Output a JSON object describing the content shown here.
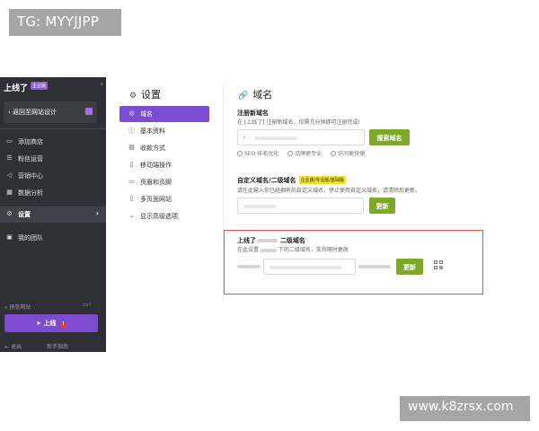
{
  "watermark": {
    "tag": "TG: MYYJJPP",
    "site": "www.k8zrsx.com"
  },
  "sidebar": {
    "logo": "上线了",
    "badge": "企业版",
    "collapse_icon": "chevron-left",
    "back_label": "返回至网站设计",
    "items": [
      {
        "label": "添加商店",
        "icon": "store-icon"
      },
      {
        "label": "粉丝运营",
        "icon": "fans-icon"
      },
      {
        "label": "营销中心",
        "icon": "megaphone-icon"
      },
      {
        "label": "数据分析",
        "icon": "chart-icon"
      },
      {
        "label": "设置",
        "icon": "gear-icon",
        "active": true
      },
      {
        "label": "我的团队",
        "icon": "team-icon"
      }
    ],
    "search_label": "预览网站",
    "publish_label": "上线",
    "publish_badge": "!",
    "bottom_left": "退出",
    "bottom_right": "新手指南"
  },
  "settings": {
    "title": "设置",
    "menu": [
      {
        "label": "域名",
        "icon": "globe-icon",
        "active": true
      },
      {
        "label": "基本资料",
        "icon": "info-icon"
      },
      {
        "label": "收款方式",
        "icon": "card-icon"
      },
      {
        "label": "移动端操作",
        "icon": "mobile-icon"
      },
      {
        "label": "页眉和页脚",
        "icon": "layout-icon"
      },
      {
        "label": "多页面网站",
        "icon": "pages-icon"
      },
      {
        "label": "显示高级选项",
        "icon": "chevron-down-icon"
      }
    ]
  },
  "domain": {
    "title": "域名",
    "register": {
      "title": "注册新域名",
      "desc": "在 [上线了] 注册新域名，仅需几分钟即可注册完成!",
      "button": "搜索域名",
      "checks": [
        "SEO 排名优化",
        "品牌更专业",
        "访问更快捷"
      ]
    },
    "custom": {
      "title": "自定义域名/二级域名",
      "badge": "企业版/专业版/基础版",
      "desc": "请在此输入你已经拥有的自定义域名，停止使用自定义域名，请清除后更新。",
      "button": "更新"
    },
    "sub": {
      "title_prefix": "上线了",
      "title_suffix": "二级域名",
      "desc_prefix": "在此设置",
      "desc_suffix": "下的二级域名，支持随时更改",
      "button": "更新"
    }
  },
  "colors": {
    "sidebar_bg": "#2f3035",
    "accent_purple": "#7d4bd0",
    "green_button": "#7bab23",
    "highlight_red": "#d9534f"
  }
}
